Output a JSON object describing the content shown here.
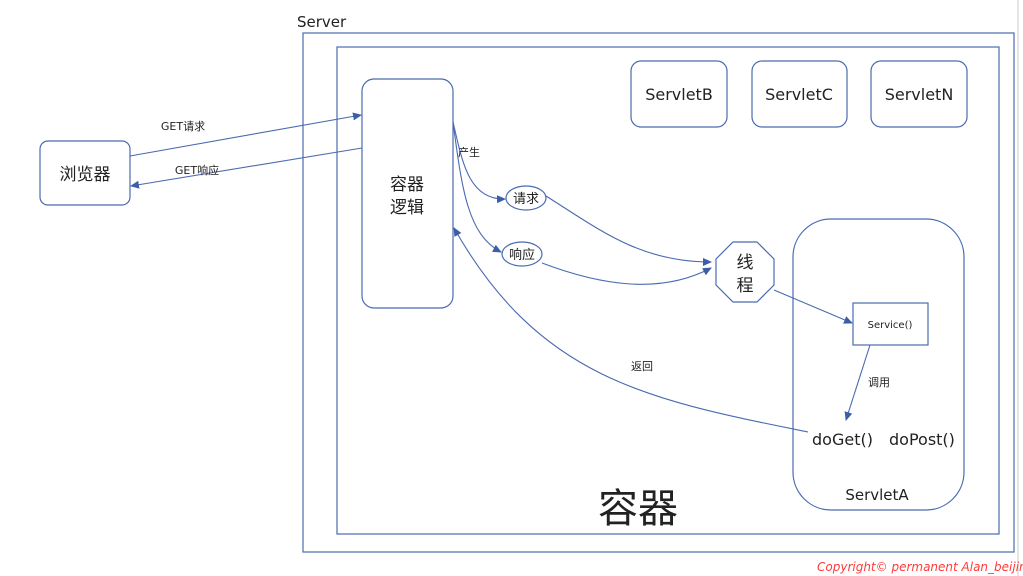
{
  "server_label": "Server",
  "container_label": "容器",
  "browser": "浏览器",
  "container_logic": [
    "容器",
    "逻辑"
  ],
  "get_request": "GET请求",
  "get_response": "GET响应",
  "produce": "产生",
  "request": "请求",
  "response": "响应",
  "thread": [
    "线",
    "程"
  ],
  "servlets": [
    "ServletB",
    "ServletC",
    "ServletN"
  ],
  "servlet_a": {
    "name": "ServletA",
    "service": "Service()",
    "call": "调用",
    "doget": "doGet()",
    "dopost": "doPost()"
  },
  "return_label": "返回",
  "copyright": "Copyright© permanent  Alan_beijing",
  "colors": {
    "line": "#4a6bb0",
    "copyright": "#ff3b3b"
  }
}
